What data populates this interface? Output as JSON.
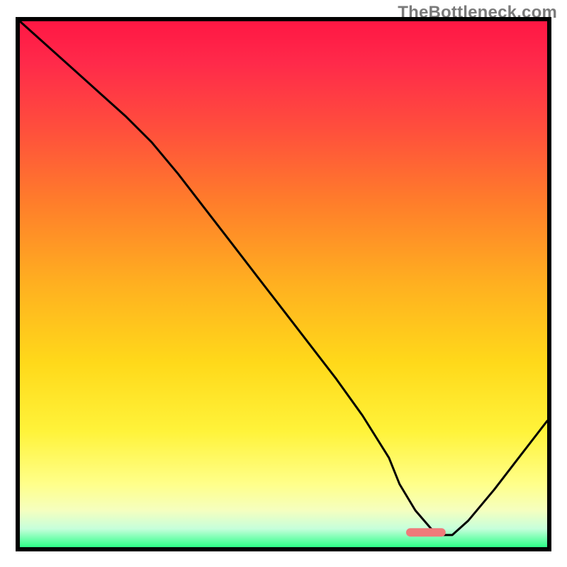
{
  "watermark": "TheBottleneck.com",
  "border": {
    "stroke": "#000000",
    "width": 6
  },
  "gradient_stops": [
    {
      "offset": 0.0,
      "color": "#ff1744"
    },
    {
      "offset": 0.08,
      "color": "#ff2a4a"
    },
    {
      "offset": 0.2,
      "color": "#ff4d3d"
    },
    {
      "offset": 0.35,
      "color": "#ff7f2a"
    },
    {
      "offset": 0.5,
      "color": "#ffb020"
    },
    {
      "offset": 0.65,
      "color": "#ffd91a"
    },
    {
      "offset": 0.78,
      "color": "#fff33a"
    },
    {
      "offset": 0.88,
      "color": "#ffff8a"
    },
    {
      "offset": 0.93,
      "color": "#f5ffbf"
    },
    {
      "offset": 0.965,
      "color": "#c6ffdb"
    },
    {
      "offset": 1.0,
      "color": "#2cff87"
    }
  ],
  "marker": {
    "x_frac": 0.77,
    "y_frac": 0.972,
    "w_frac": 0.075,
    "h_frac": 0.016,
    "fill": "#ef7a7a",
    "rx": 6
  },
  "chart_data": {
    "type": "line",
    "title": "",
    "xlabel": "",
    "ylabel": "",
    "xlim": [
      0,
      100
    ],
    "ylim": [
      0,
      100
    ],
    "x": [
      0,
      5,
      10,
      15,
      20,
      25,
      30,
      35,
      40,
      45,
      50,
      55,
      60,
      65,
      70,
      72,
      75,
      78,
      80,
      82,
      85,
      90,
      95,
      100
    ],
    "values": [
      100,
      95.5,
      91,
      86.5,
      82,
      77,
      71,
      64.5,
      58,
      51.5,
      45,
      38.5,
      32,
      25,
      17,
      12,
      7,
      3.5,
      2.3,
      2.3,
      5,
      11,
      17.5,
      24
    ],
    "series": [
      {
        "name": "bottleneck-curve",
        "stroke": "#000000",
        "width": 3
      }
    ],
    "optimal_range_x": [
      73,
      80
    ]
  }
}
